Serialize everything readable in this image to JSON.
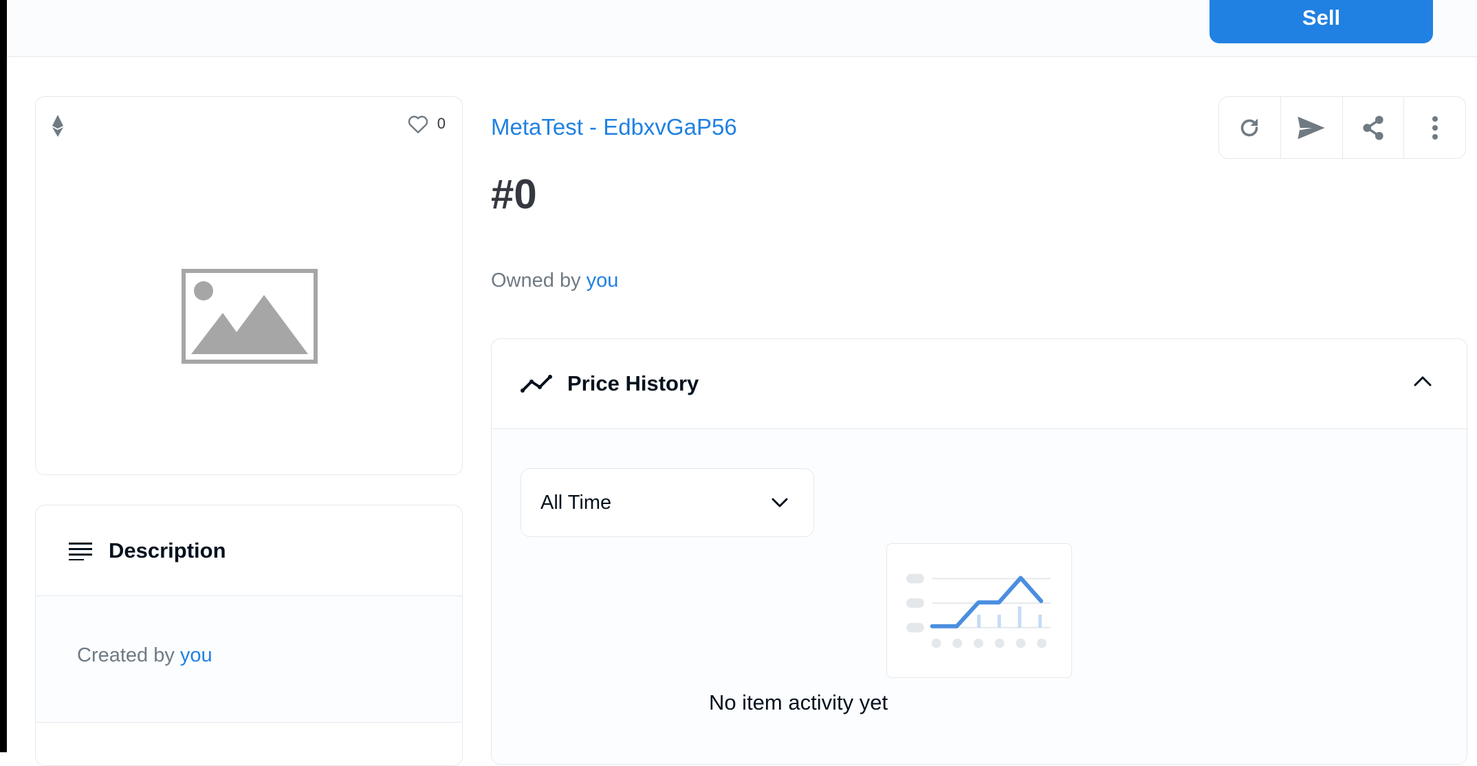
{
  "topbar": {
    "sell_label": "Sell"
  },
  "media": {
    "favorites_count": "0"
  },
  "description": {
    "title": "Description",
    "created_prefix": "Created by",
    "created_by": "you"
  },
  "item": {
    "collection": "MetaTest - EdbxvGaP56",
    "title": "#0",
    "owned_prefix": "Owned by",
    "owner": "you"
  },
  "price_history": {
    "title": "Price History",
    "time_filter": "All Time",
    "empty_message": "No item activity yet"
  },
  "colors": {
    "accent": "#2081e2",
    "text": "#04111d",
    "muted": "#707a83",
    "border": "#e5e8eb"
  }
}
